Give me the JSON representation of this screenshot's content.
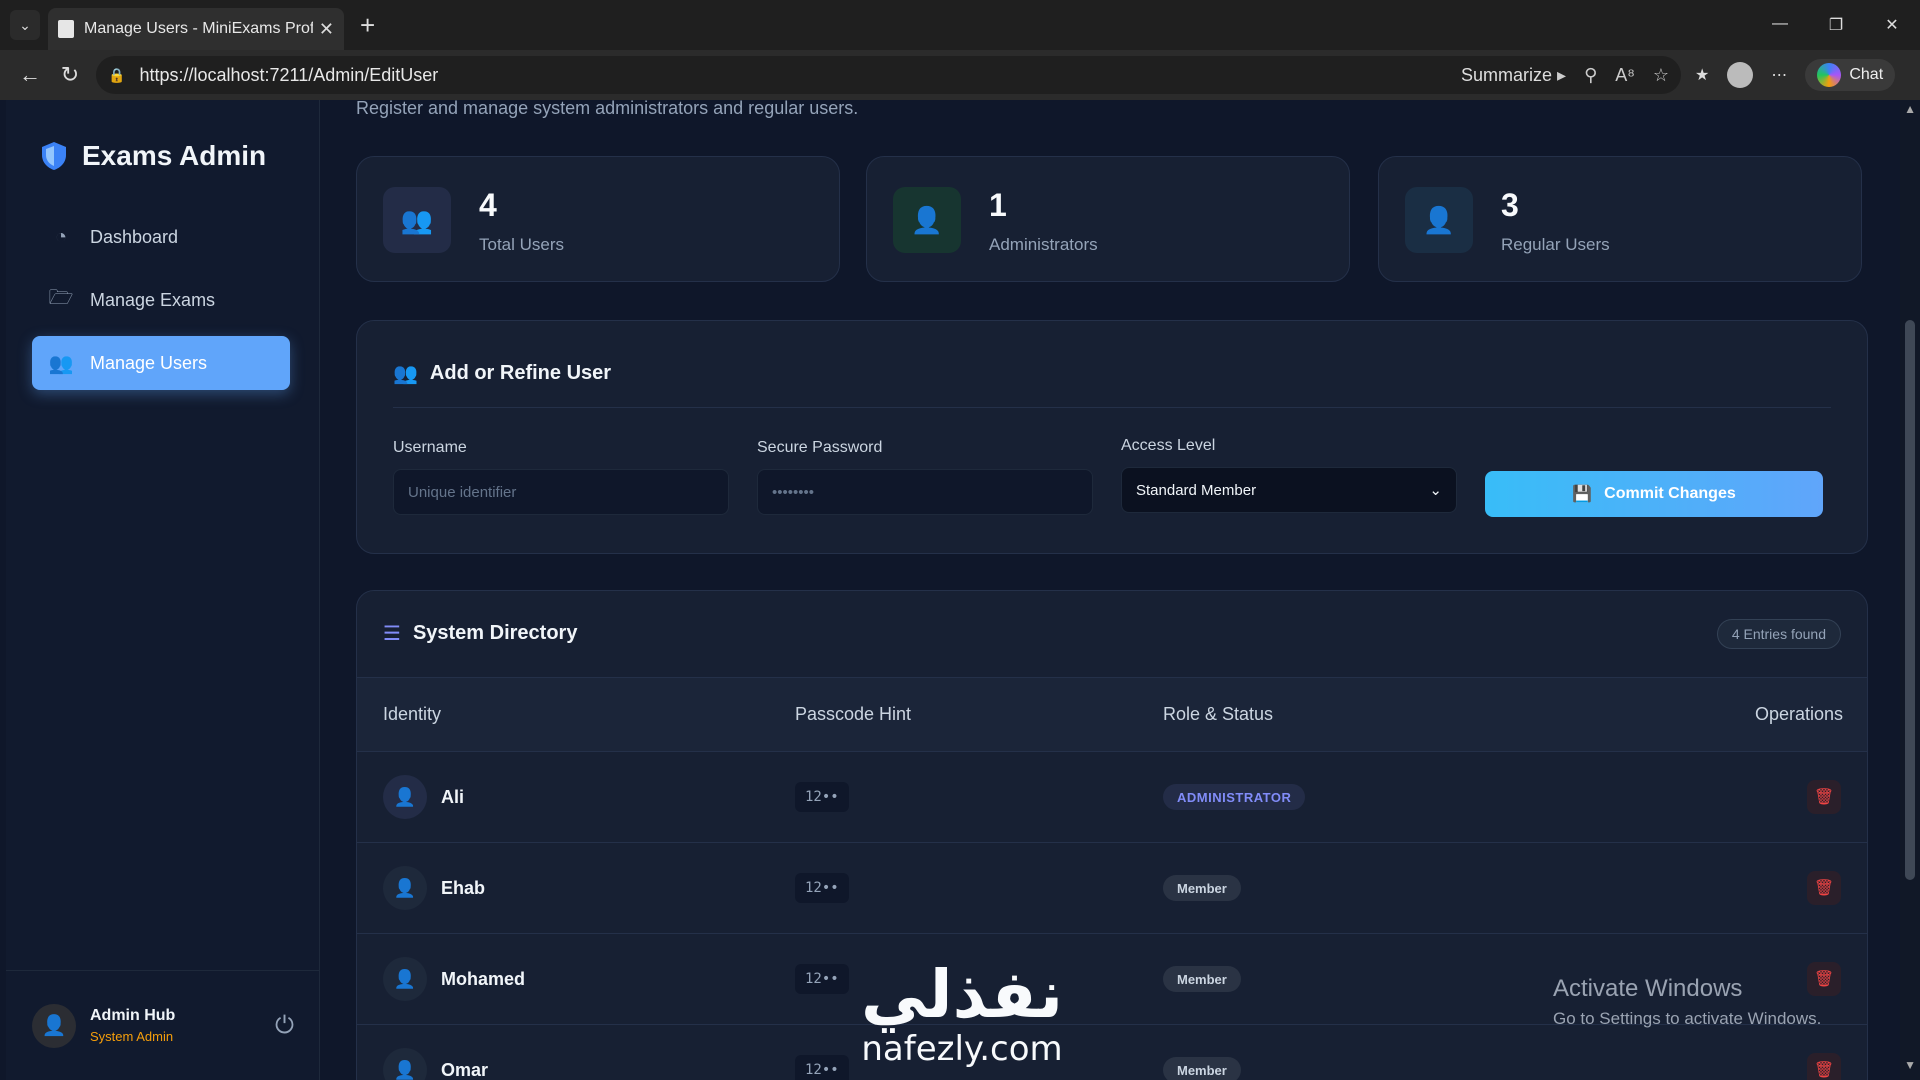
{
  "browser": {
    "tab_title": "Manage Users - MiniExams Profes",
    "url": "https://localhost:7211/Admin/EditUser",
    "summarize_label": "Summarize",
    "chat_label": "Chat"
  },
  "sidebar": {
    "brand": "Exams Admin",
    "items": [
      {
        "label": "Dashboard",
        "icon": "pie-chart-icon",
        "active": false
      },
      {
        "label": "Manage Exams",
        "icon": "folder-open-icon",
        "active": false
      },
      {
        "label": "Manage Users",
        "icon": "users-icon",
        "active": true
      }
    ],
    "footer": {
      "name": "Admin Hub",
      "role": "System Admin"
    }
  },
  "header": {
    "subtitle": "Register and manage system administrators and regular users."
  },
  "stats": [
    {
      "value": "4",
      "label": "Total Users",
      "icon": "users-icon",
      "color": "#818cf8",
      "bg": "#232c47"
    },
    {
      "value": "1",
      "label": "Administrators",
      "icon": "user-shield-icon",
      "color": "#10b981",
      "bg": "#173530"
    },
    {
      "value": "3",
      "label": "Regular Users",
      "icon": "user-icon",
      "color": "#38bdf8",
      "bg": "#1a2e44"
    }
  ],
  "form": {
    "title": "Add or Refine User",
    "username_label": "Username",
    "username_placeholder": "Unique identifier",
    "password_label": "Secure Password",
    "password_placeholder": "••••••••",
    "access_label": "Access Level",
    "access_selected": "Standard Member",
    "commit_label": "Commit Changes"
  },
  "directory": {
    "title": "System Directory",
    "entries_badge": "4 Entries found",
    "columns": [
      "Identity",
      "Passcode Hint",
      "Role & Status",
      "Operations"
    ],
    "rows": [
      {
        "name": "Ali",
        "hint": "12••",
        "role": "ADMINISTRATOR",
        "admin": true
      },
      {
        "name": "Ehab",
        "hint": "12••",
        "role": "Member",
        "admin": false
      },
      {
        "name": "Mohamed",
        "hint": "12••",
        "role": "Member",
        "admin": false
      },
      {
        "name": "Omar",
        "hint": "12••",
        "role": "Member",
        "admin": false
      }
    ]
  },
  "overlay": {
    "activate_title": "Activate Windows",
    "activate_sub": "Go to Settings to activate Windows.",
    "watermark_ar": "نفذلي",
    "watermark_en": "nafezly.com"
  }
}
